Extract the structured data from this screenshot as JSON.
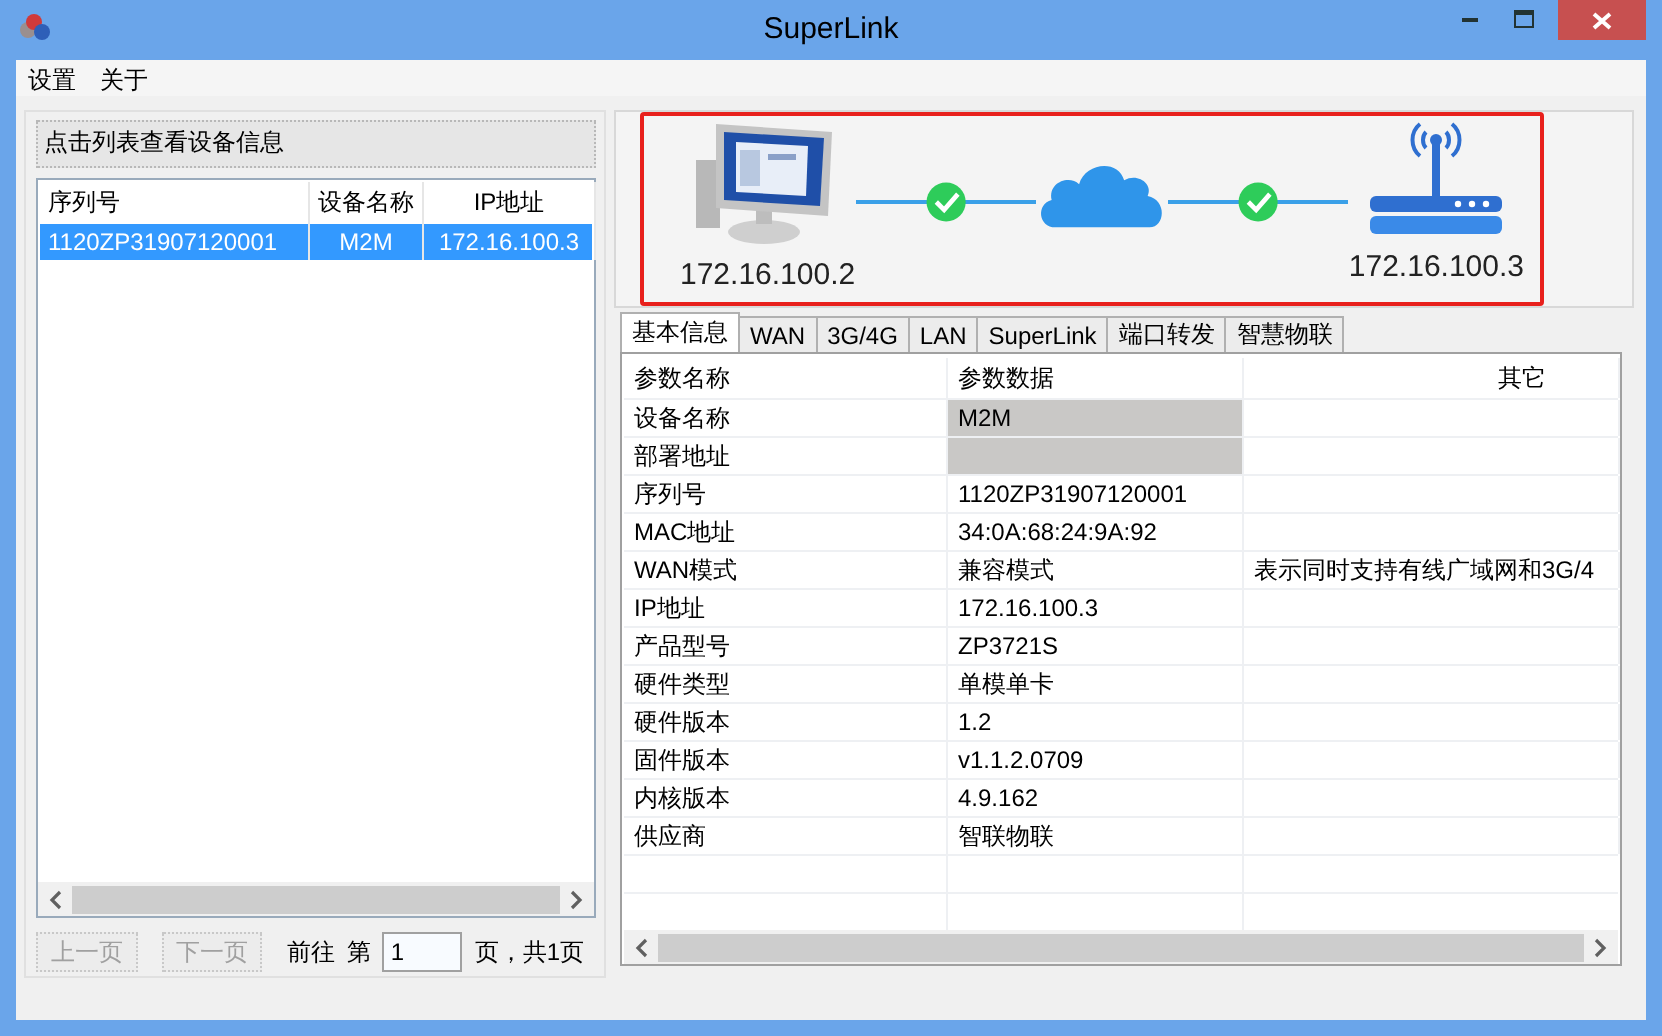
{
  "window": {
    "title": "SuperLink"
  },
  "menu": [
    {
      "label": "设置"
    },
    {
      "label": "关于"
    }
  ],
  "device_list": {
    "header": "点击列表查看设备信息",
    "columns": [
      "序列号",
      "设备名称",
      "IP地址"
    ],
    "rows": [
      {
        "cells": [
          "1120ZP31907120001",
          "M2M",
          "172.16.100.3"
        ],
        "selected": true
      }
    ]
  },
  "pager": {
    "prev": {
      "label": "上一页",
      "disabled": true
    },
    "next": {
      "label": "下一页",
      "disabled": true
    },
    "goto_label": "前往",
    "page_prefix": "第",
    "page_value": "1",
    "page_suffix": "页，共1页"
  },
  "topology": {
    "local_ip": "172.16.100.2",
    "remote_ip": "172.16.100.3",
    "links": [
      {
        "ok": true
      },
      {
        "ok": true
      }
    ]
  },
  "tabs": [
    {
      "label": "基本信息",
      "selected": true
    },
    {
      "label": "WAN",
      "selected": false
    },
    {
      "label": "3G/4G",
      "selected": false
    },
    {
      "label": "LAN",
      "selected": false
    },
    {
      "label": "SuperLink",
      "selected": false
    },
    {
      "label": "端口转发",
      "selected": false
    },
    {
      "label": "智慧物联",
      "selected": false
    }
  ],
  "info_table": {
    "columns": [
      "参数名称",
      "参数数据",
      "其它"
    ],
    "rows": [
      {
        "name": "设备名称",
        "kind": "field",
        "value": "M2M"
      },
      {
        "name": "部署地址",
        "kind": "field"
      },
      {
        "name": "序列号",
        "kind": "text",
        "value": "1120ZP31907120001"
      },
      {
        "name": "MAC地址",
        "kind": "text",
        "value": "34:0A:68:24:9A:92"
      },
      {
        "name": "WAN模式",
        "kind": "text",
        "value": "兼容模式",
        "other": "表示同时支持有线广域网和3G/4"
      },
      {
        "name": "IP地址",
        "kind": "text",
        "value": "172.16.100.3"
      },
      {
        "name": "产品型号",
        "kind": "text",
        "value": "ZP3721S"
      },
      {
        "name": "硬件类型",
        "kind": "text",
        "value": "单模单卡"
      },
      {
        "name": "硬件版本",
        "kind": "text",
        "value": "1.2"
      },
      {
        "name": "固件版本",
        "kind": "text",
        "value": "v1.1.2.0709"
      },
      {
        "name": "内核版本",
        "kind": "text",
        "value": "4.9.162"
      },
      {
        "name": "供应商",
        "kind": "text",
        "value": "智联物联"
      }
    ]
  }
}
